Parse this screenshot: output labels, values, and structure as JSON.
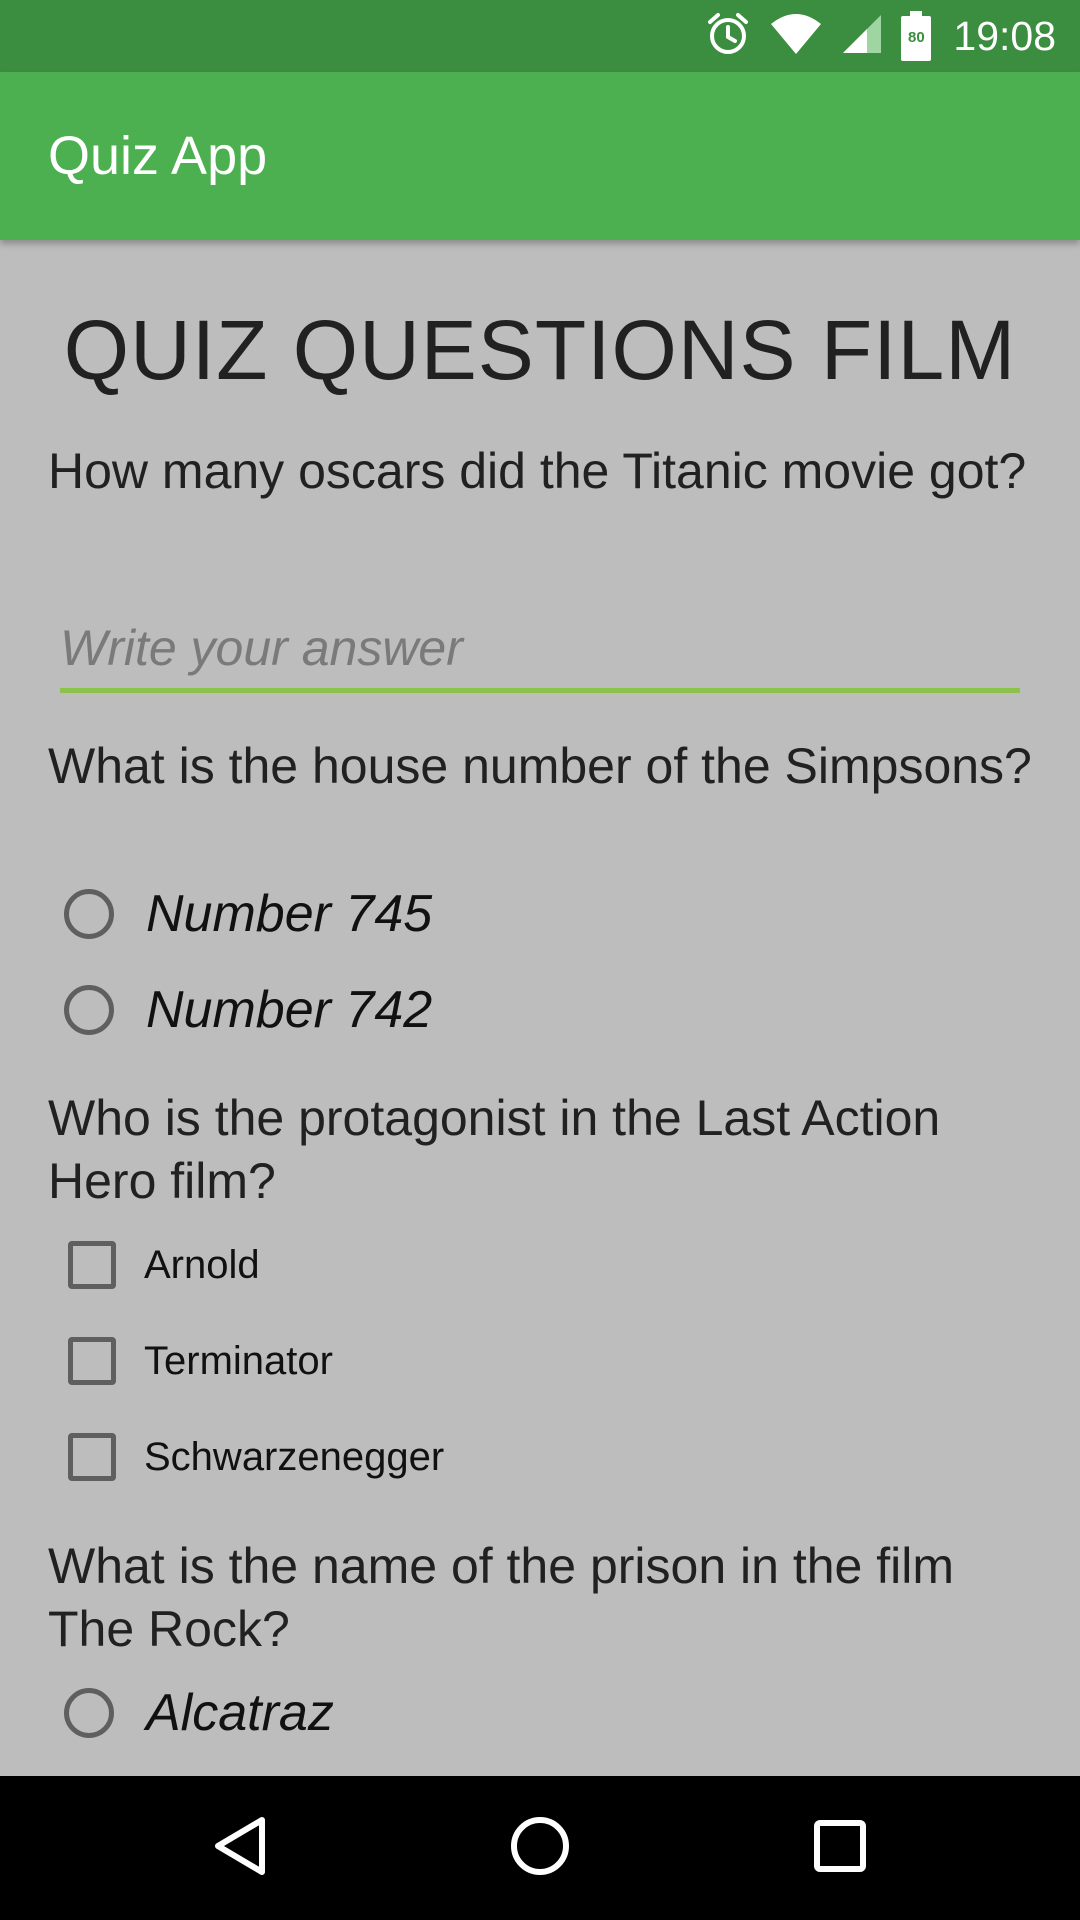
{
  "status_bar": {
    "time": "19:08",
    "battery_level": "80",
    "icons": [
      "alarm-icon",
      "wifi-icon",
      "signal-icon",
      "battery-icon"
    ]
  },
  "app_bar": {
    "title": "Quiz App"
  },
  "main": {
    "title": "QUIZ QUESTIONS FILM",
    "q1": {
      "text": "How many oscars did the Titanic movie got?",
      "placeholder": "Write your answer",
      "value": ""
    },
    "q2": {
      "text": "What is the house number of the Simpsons?",
      "options": [
        "Number 745",
        "Number 742"
      ]
    },
    "q3": {
      "text": "Who is the protagonist in the Last Action Hero film?",
      "options": [
        "Arnold",
        "Terminator",
        "Schwarzenegger"
      ]
    },
    "q4": {
      "text": "What is the name of the prison in the film The Rock?",
      "options": [
        "Alcatraz"
      ]
    }
  },
  "nav_bar": {
    "icons": [
      "back-icon",
      "home-icon",
      "recents-icon"
    ]
  },
  "colors": {
    "status_bar": "#3b8e3f",
    "app_bar": "#4caf50",
    "background": "#bdbdbd",
    "input_underline": "#8bc34a",
    "nav_bar": "#000000"
  }
}
